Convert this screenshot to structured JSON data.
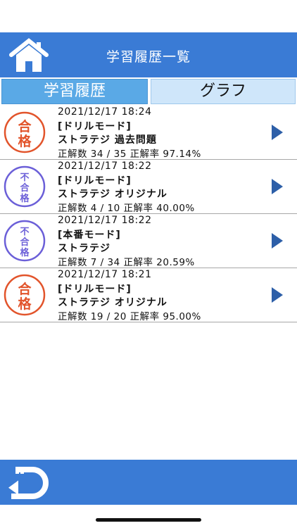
{
  "header": {
    "title": "学習履歴一覧",
    "home_icon": "house-icon"
  },
  "tabs": [
    {
      "label": "学習履歴",
      "active": true
    },
    {
      "label": "グラフ",
      "active": false
    }
  ],
  "colors": {
    "accent": "#3a7bd5",
    "pass": "#e2542b",
    "fail": "#6b5fd8",
    "arrow": "#2d5fa8"
  },
  "history": [
    {
      "badge": "合格",
      "date": "2021/12/17 18:24",
      "mode": "[ドリルモード]",
      "title": "ストラテジ 過去問題",
      "score": "正解数 34 / 35 正解率 97.14%"
    },
    {
      "badge": "不合格",
      "date": "2021/12/17 18:22",
      "mode": "[ドリルモード]",
      "title": "ストラテジ オリジナル",
      "score": "正解数 4 / 10 正解率 40.00%"
    },
    {
      "badge": "不合格",
      "date": "2021/12/17 18:22",
      "mode": "[本番モード]",
      "title": "ストラテジ",
      "score": "正解数 7 / 34 正解率 20.59%"
    },
    {
      "badge": "合格",
      "date": "2021/12/17 18:21",
      "mode": "[ドリルモード]",
      "title": "ストラテジ オリジナル",
      "score": "正解数 19 / 20 正解率 95.00%"
    }
  ],
  "footer": {
    "back_icon": "back-arrow-icon"
  }
}
